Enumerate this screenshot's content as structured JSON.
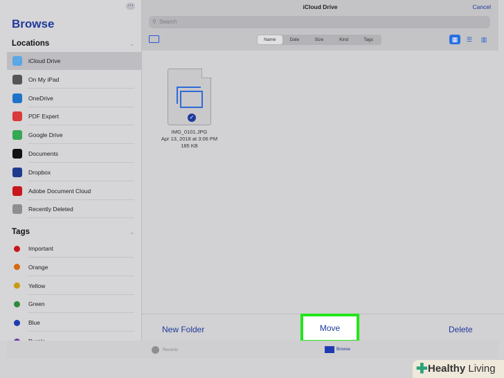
{
  "sidebar": {
    "title": "Browse",
    "more": "···",
    "locations_header": "Locations",
    "tags_header": "Tags",
    "locations": [
      {
        "label": "iCloud Drive",
        "icon": "icloud-icon",
        "color": "#5aa8e6",
        "selected": true
      },
      {
        "label": "On My iPad",
        "icon": "ipad-icon",
        "color": "#555555"
      },
      {
        "label": "OneDrive",
        "icon": "onedrive-icon",
        "color": "#1e73c8"
      },
      {
        "label": "PDF Expert",
        "icon": "pdf-expert-icon",
        "color": "#d93a3a"
      },
      {
        "label": "Google Drive",
        "icon": "google-drive-icon",
        "color": "#34a853"
      },
      {
        "label": "Documents",
        "icon": "documents-icon",
        "color": "#111111"
      },
      {
        "label": "Dropbox",
        "icon": "dropbox-icon",
        "color": "#1f3a8f"
      },
      {
        "label": "Adobe Document Cloud",
        "icon": "adobe-icon",
        "color": "#c8161d"
      },
      {
        "label": "Recently Deleted",
        "icon": "trash-icon",
        "color": "#8e8d91"
      }
    ],
    "tags": [
      {
        "label": "Important",
        "color": "#c8161d"
      },
      {
        "label": "Orange",
        "color": "#d46a12"
      },
      {
        "label": "Yellow",
        "color": "#c89a10"
      },
      {
        "label": "Green",
        "color": "#2e8a3a"
      },
      {
        "label": "Blue",
        "color": "#1f3ab0"
      },
      {
        "label": "Purple",
        "color": "#6a3aa0"
      }
    ]
  },
  "header": {
    "title": "iCloud Drive",
    "cancel": "Cancel",
    "search_placeholder": "Search",
    "sort": [
      "Name",
      "Date",
      "Size",
      "Kind",
      "Tags"
    ],
    "sort_selected": "Name"
  },
  "file": {
    "name": "IMG_0101.JPG",
    "date": "Apr 13, 2018 at 3:06 PM",
    "size": "185 KB",
    "selected": true
  },
  "toolbar": {
    "new_folder": "New Folder",
    "move": "Move",
    "delete": "Delete"
  },
  "tabbar": {
    "recents": "Recents",
    "browse": "Browse"
  },
  "watermark": "Healthy Living",
  "colors": {
    "accent": "#1f3a9b",
    "highlight": "#22e61c"
  }
}
